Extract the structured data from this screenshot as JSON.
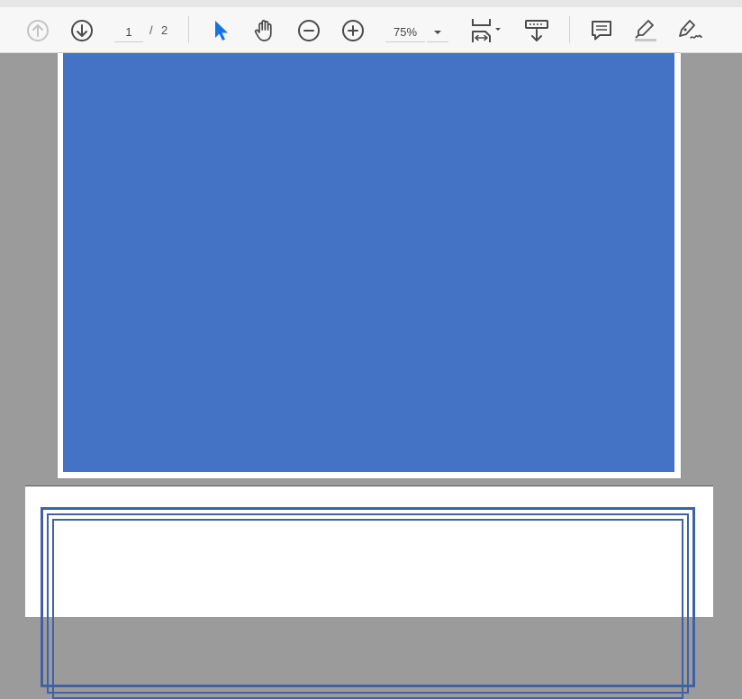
{
  "toolbar": {
    "buttons": [
      {
        "name": "previous-page",
        "icon": "arrow-up-circle-icon",
        "state": "disabled"
      },
      {
        "name": "next-page",
        "icon": "arrow-down-circle-icon"
      },
      {
        "name": "select-tool",
        "icon": "pointer-arrow-icon",
        "state": "active"
      },
      {
        "name": "hand-tool",
        "icon": "hand-icon"
      },
      {
        "name": "zoom-out",
        "icon": "minus-circle-icon"
      },
      {
        "name": "zoom-in",
        "icon": "plus-circle-icon"
      },
      {
        "name": "page-fit",
        "icon": "fit-width-icon"
      },
      {
        "name": "scroll-mode",
        "icon": "scroll-mode-icon"
      },
      {
        "name": "comment",
        "icon": "comment-icon"
      },
      {
        "name": "highlight",
        "icon": "highlighter-icon"
      },
      {
        "name": "sign",
        "icon": "pen-sign-icon"
      }
    ],
    "page_current": "1",
    "page_separator": "/",
    "page_total": "2",
    "zoom": "75%"
  },
  "colors": {
    "toolbar_bg": "#f7f7f7",
    "workspace_bg": "#9b9b9b",
    "page1_fill": "#4472c4",
    "page2_border": "#3f61a6",
    "active_tool": "#1473e6",
    "icon": "#4b4b4b"
  }
}
